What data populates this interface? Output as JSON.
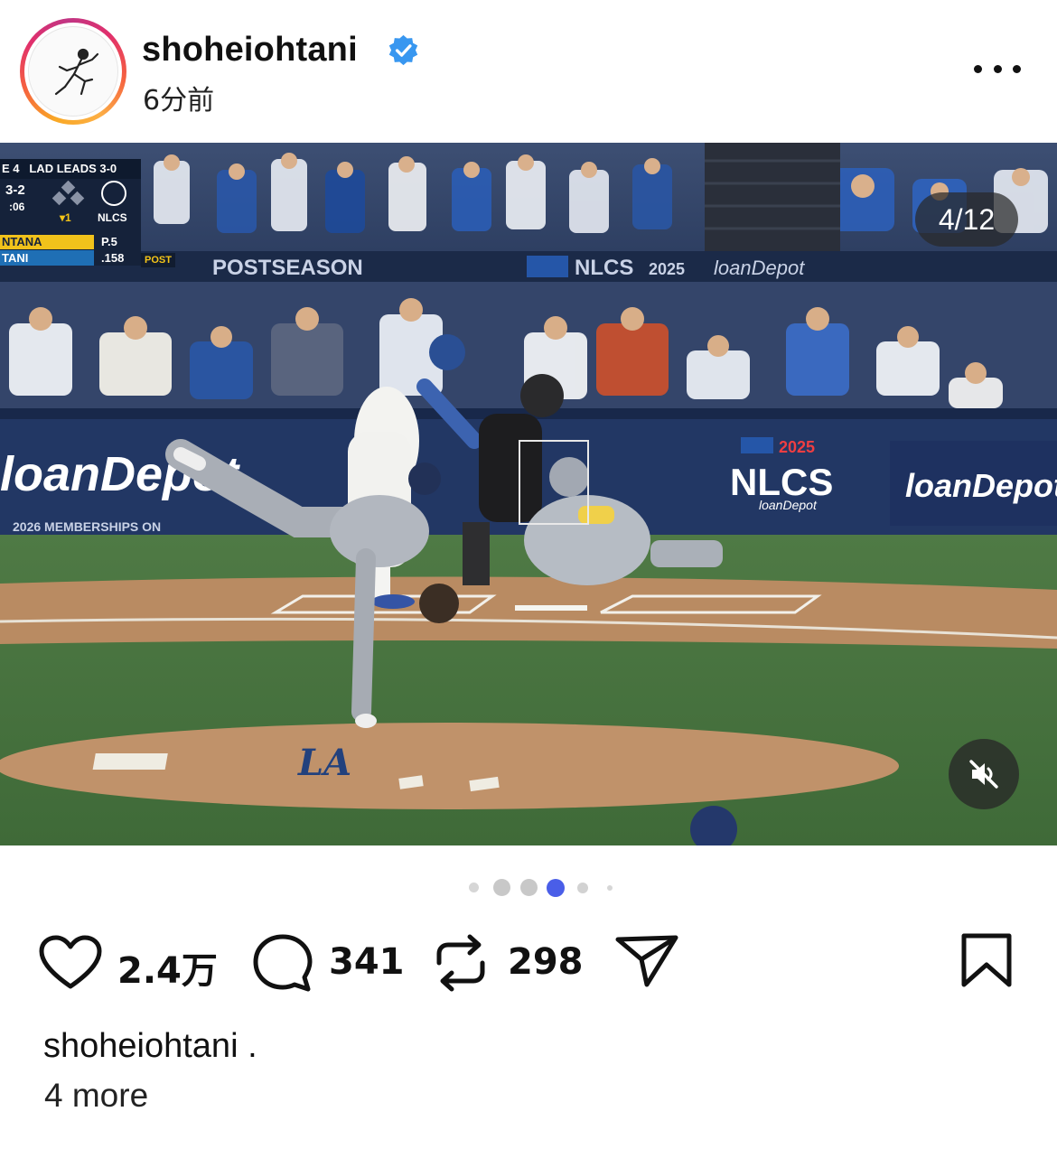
{
  "header": {
    "username": "shoheiohtani",
    "time_ago": "6分前",
    "verified_icon": "verified-badge-icon",
    "more_icon": "more-options-icon"
  },
  "media": {
    "counter": "4/12",
    "mute_icon": "muted-speaker-icon",
    "scorebug": {
      "game": "E 4",
      "series": "LAD LEADS 3-0",
      "count": "3-2",
      "clock": ":06",
      "outs": "▾1",
      "network": "NLCS",
      "player1": "NTANA",
      "player1_stat": "P.5",
      "player2": "TANI",
      "player2_stat": ".158",
      "tag": "POST"
    },
    "banners": {
      "postseason": "POSTSEASON",
      "nlcs_top": "NLCS",
      "year": "2025",
      "sponsor": "loanDepot",
      "wall_left": "loanDepot",
      "wall_right": "loanDepot",
      "wall_nlcs": "NLCS",
      "wall_note": "2026 MEMBERSHIPS ON",
      "mound_logo": "LA"
    }
  },
  "carousel": {
    "total_dots": 6,
    "active_index": 3,
    "active_color": "#4a5ee8"
  },
  "actions": {
    "likes": "2.4万",
    "comments": "341",
    "reposts": "298",
    "like_icon": "heart-icon",
    "comment_icon": "comment-icon",
    "repost_icon": "repost-icon",
    "share_icon": "share-icon",
    "save_icon": "bookmark-icon"
  },
  "caption": {
    "username": "shoheiohtani .",
    "more": "4 more"
  },
  "colors": {
    "ring_orange": "#f56040",
    "ring_pink": "#e1306c",
    "verified_blue": "#3897f0"
  }
}
